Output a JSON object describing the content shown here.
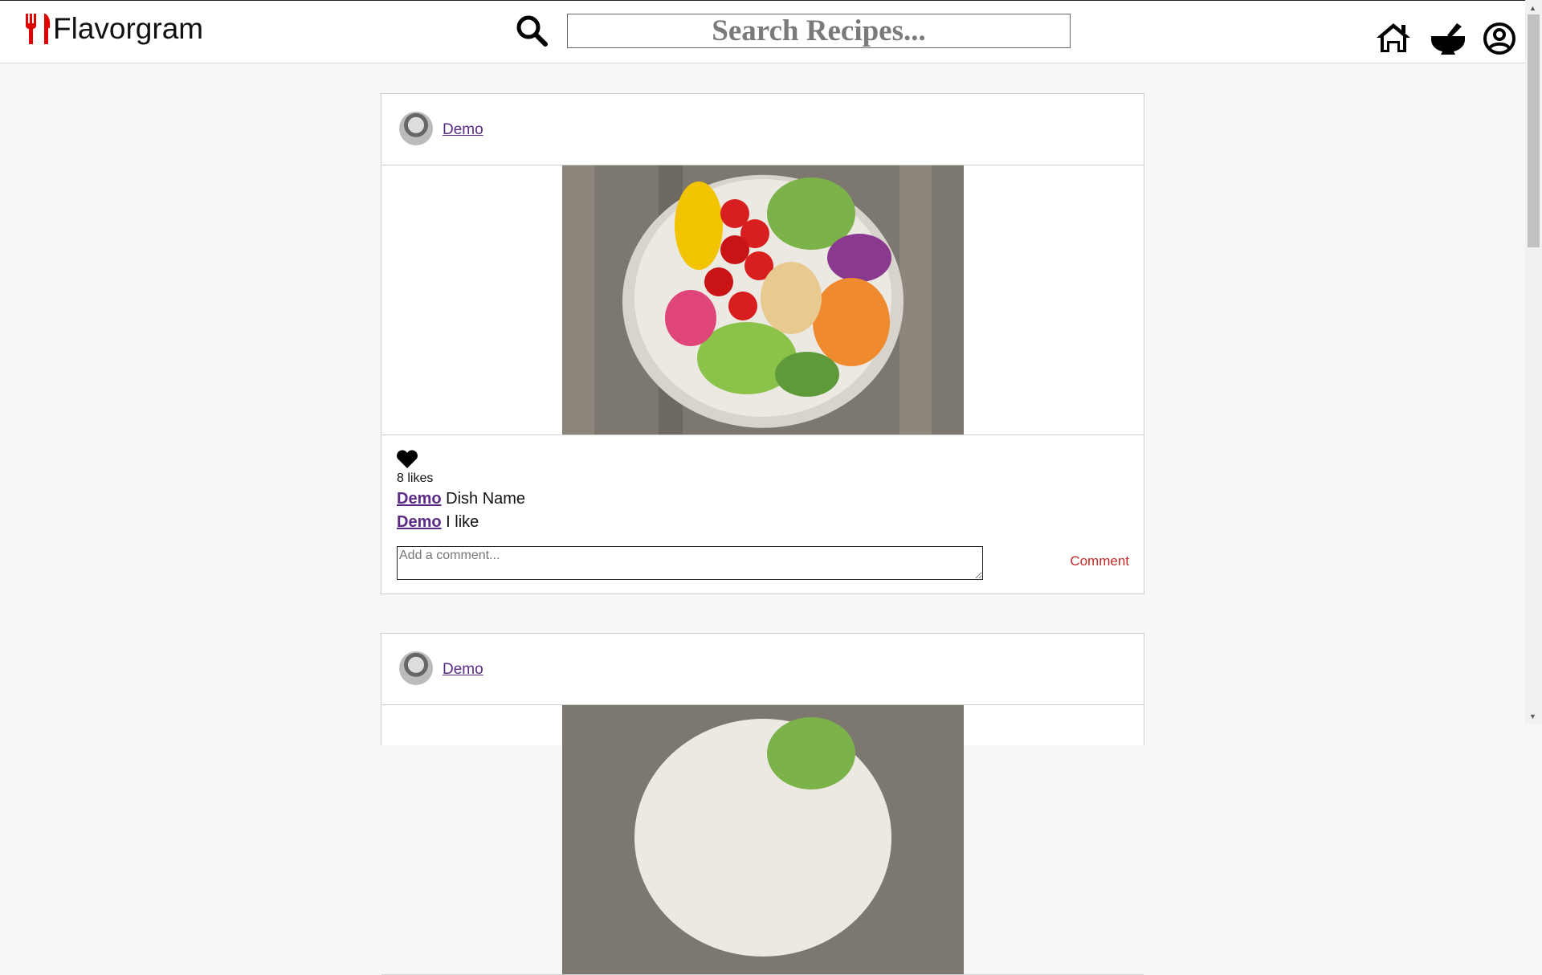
{
  "app": {
    "name": "Flavorgram",
    "accent_color": "#e00000",
    "link_color": "#5b2a86"
  },
  "header": {
    "search_placeholder": "Search Recipes...",
    "icons": [
      "search-icon",
      "home-icon",
      "mortar-pestle-icon",
      "account-circle-icon"
    ]
  },
  "posts": [
    {
      "username": "Demo",
      "image": "salad bowl with tomatoes, chickpeas, avocado, sweet potato, red cabbage",
      "likes_text": "8 likes",
      "caption_user": "Demo",
      "caption_text": "Dish Name",
      "comments": [
        {
          "user": "Demo",
          "text": "I like"
        }
      ],
      "comment_placeholder": "Add a comment...",
      "comment_button": "Comment"
    },
    {
      "username": "Demo",
      "image": "salad bowl"
    }
  ]
}
